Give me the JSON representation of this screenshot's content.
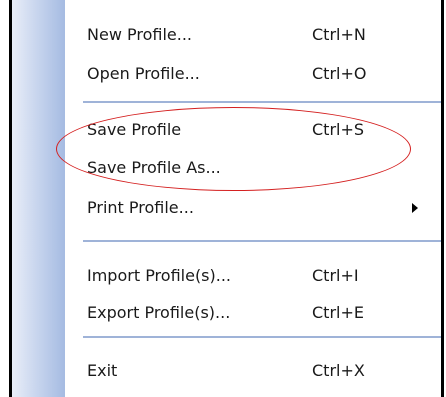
{
  "menu": {
    "items": [
      {
        "label": "New Profile...",
        "shortcut": "Ctrl+N"
      },
      {
        "label": "Open Profile...",
        "shortcut": "Ctrl+O"
      },
      {
        "label": "Save Profile",
        "shortcut": "Ctrl+S"
      },
      {
        "label": "Save Profile As...",
        "shortcut": ""
      },
      {
        "label": "Print Profile...",
        "shortcut": ""
      },
      {
        "label": "Import Profile(s)...",
        "shortcut": "Ctrl+I"
      },
      {
        "label": "Export Profile(s)...",
        "shortcut": "Ctrl+E"
      },
      {
        "label": "Exit",
        "shortcut": "Ctrl+X"
      }
    ]
  },
  "colors": {
    "highlight": "#d42020",
    "separator": "#9fb3d8",
    "gutter": "#a5bbe2"
  }
}
